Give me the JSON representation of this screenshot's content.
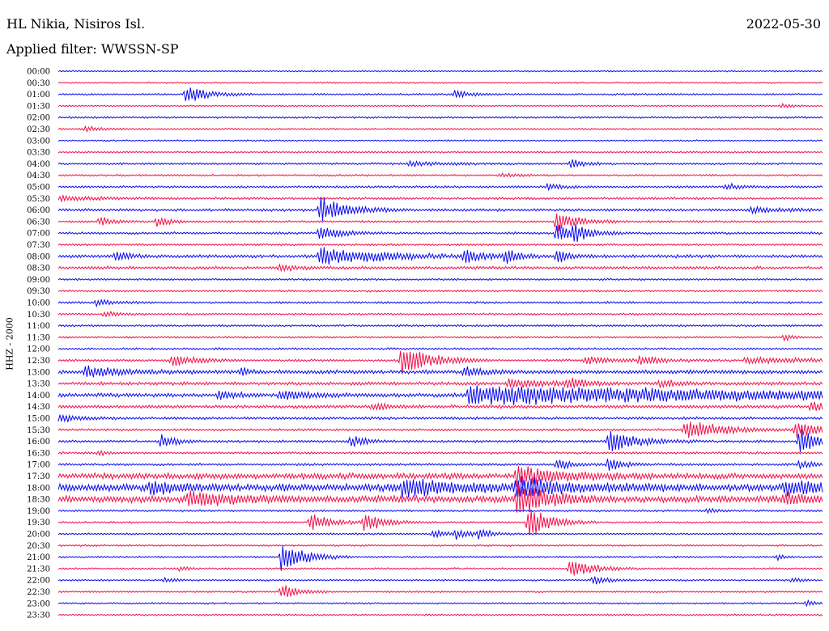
{
  "header": {
    "station": "HL Nikia, Nisiros Isl.",
    "date": "2022-05-30",
    "filter": "Applied filter: WWSSN-SP"
  },
  "chart_data": {
    "type": "line",
    "title": "HL Nikia, Nisiros Isl.",
    "ylabel": "HHZ - 2000",
    "grid": false,
    "legend": "none",
    "colors": [
      "#0a0af0",
      "#f0104a"
    ],
    "row_labels": [
      "00:00",
      "00:30",
      "01:00",
      "01:30",
      "02:00",
      "02:30",
      "03:00",
      "03:30",
      "04:00",
      "04:30",
      "05:00",
      "05:30",
      "06:00",
      "06:30",
      "07:00",
      "07:30",
      "08:00",
      "08:30",
      "09:00",
      "09:30",
      "10:00",
      "10:30",
      "11:00",
      "11:30",
      "12:00",
      "12:30",
      "13:00",
      "13:30",
      "14:00",
      "14:30",
      "15:00",
      "15:30",
      "16:00",
      "16:30",
      "17:00",
      "17:30",
      "18:00",
      "18:30",
      "19:00",
      "19:30",
      "20:00",
      "20:30",
      "21:00",
      "21:30",
      "22:00",
      "22:30",
      "23:00",
      "23:30"
    ],
    "row_noise": [
      1,
      1,
      1.2,
      1,
      1.3,
      1.2,
      1,
      1.2,
      1.4,
      1.3,
      1.5,
      1.6,
      1.8,
      1.4,
      1.6,
      1.4,
      2.2,
      2,
      1.3,
      1.3,
      1.5,
      1.4,
      1.4,
      1.3,
      1.4,
      1.6,
      2.6,
      2.3,
      2.6,
      2.2,
      1.8,
      1.6,
      1.6,
      1.5,
      1.6,
      4,
      5,
      4.5,
      1.4,
      1.3,
      1.2,
      1.2,
      1.2,
      1.2,
      1.2,
      1.2,
      1.2,
      1.2
    ],
    "events": [
      {
        "row": "01:00",
        "t": 0.167,
        "amp": 12,
        "dur": 0.03
      },
      {
        "row": "01:00",
        "t": 0.519,
        "amp": 6,
        "dur": 0.02
      },
      {
        "row": "01:30",
        "t": 0.947,
        "amp": 5,
        "dur": 0.01
      },
      {
        "row": "02:30",
        "t": 0.036,
        "amp": 4,
        "dur": 0.02
      },
      {
        "row": "04:00",
        "t": 0.46,
        "amp": 3,
        "dur": 0.06
      },
      {
        "row": "04:00",
        "t": 0.67,
        "amp": 6,
        "dur": 0.02
      },
      {
        "row": "04:30",
        "t": 0.58,
        "amp": 3,
        "dur": 0.02
      },
      {
        "row": "05:00",
        "t": 0.64,
        "amp": 4,
        "dur": 0.02
      },
      {
        "row": "05:00",
        "t": 0.874,
        "amp": 4,
        "dur": 0.02
      },
      {
        "row": "05:30",
        "t": 0.0,
        "amp": 3,
        "dur": 0.06
      },
      {
        "row": "06:00",
        "t": 0.342,
        "amp": 18,
        "dur": 0.04
      },
      {
        "row": "06:00",
        "t": 0.907,
        "amp": 4,
        "dur": 0.04
      },
      {
        "row": "06:30",
        "t": 0.054,
        "amp": 6,
        "dur": 0.02
      },
      {
        "row": "06:30",
        "t": 0.129,
        "amp": 7,
        "dur": 0.02
      },
      {
        "row": "06:30",
        "t": 0.652,
        "amp": 16,
        "dur": 0.03
      },
      {
        "row": "07:00",
        "t": 0.342,
        "amp": 10,
        "dur": 0.03
      },
      {
        "row": "07:00",
        "t": 0.652,
        "amp": 12,
        "dur": 0.03
      },
      {
        "row": "07:00",
        "t": 0.675,
        "amp": 10,
        "dur": 0.02
      },
      {
        "row": "08:00",
        "t": 0.075,
        "amp": 7,
        "dur": 0.02
      },
      {
        "row": "08:00",
        "t": 0.342,
        "amp": 14,
        "dur": 0.08
      },
      {
        "row": "08:00",
        "t": 0.532,
        "amp": 10,
        "dur": 0.02
      },
      {
        "row": "08:00",
        "t": 0.585,
        "amp": 10,
        "dur": 0.02
      },
      {
        "row": "08:00",
        "t": 0.652,
        "amp": 10,
        "dur": 0.02
      },
      {
        "row": "08:30",
        "t": 0.29,
        "amp": 5,
        "dur": 0.02
      },
      {
        "row": "10:00",
        "t": 0.05,
        "amp": 4,
        "dur": 0.03
      },
      {
        "row": "10:30",
        "t": 0.06,
        "amp": 4,
        "dur": 0.02
      },
      {
        "row": "11:30",
        "t": 0.95,
        "amp": 5,
        "dur": 0.01
      },
      {
        "row": "12:30",
        "t": 0.148,
        "amp": 10,
        "dur": 0.03
      },
      {
        "row": "12:30",
        "t": 0.449,
        "amp": 22,
        "dur": 0.04
      },
      {
        "row": "12:30",
        "t": 0.69,
        "amp": 5,
        "dur": 0.04
      },
      {
        "row": "12:30",
        "t": 0.76,
        "amp": 5,
        "dur": 0.04
      },
      {
        "row": "12:30",
        "t": 0.9,
        "amp": 4,
        "dur": 0.1
      },
      {
        "row": "13:00",
        "t": 0.036,
        "amp": 8,
        "dur": 0.05
      },
      {
        "row": "13:00",
        "t": 0.24,
        "amp": 6,
        "dur": 0.01
      },
      {
        "row": "13:00",
        "t": 0.532,
        "amp": 8,
        "dur": 0.02
      },
      {
        "row": "13:30",
        "t": 0.59,
        "amp": 7,
        "dur": 0.05
      },
      {
        "row": "13:30",
        "t": 0.666,
        "amp": 8,
        "dur": 0.02
      },
      {
        "row": "13:30",
        "t": 0.787,
        "amp": 5,
        "dur": 0.02
      },
      {
        "row": "14:00",
        "t": 0.21,
        "amp": 7,
        "dur": 0.02
      },
      {
        "row": "14:00",
        "t": 0.29,
        "amp": 6,
        "dur": 0.04
      },
      {
        "row": "14:00",
        "t": 0.537,
        "amp": 14,
        "dur": 0.45
      },
      {
        "row": "14:30",
        "t": 0.412,
        "amp": 5,
        "dur": 0.02
      },
      {
        "row": "14:30",
        "t": 0.985,
        "amp": 8,
        "dur": 0.02
      },
      {
        "row": "15:00",
        "t": 0.0,
        "amp": 6,
        "dur": 0.03
      },
      {
        "row": "15:30",
        "t": 0.82,
        "amp": 14,
        "dur": 0.05
      },
      {
        "row": "15:30",
        "t": 0.965,
        "amp": 14,
        "dur": 0.03
      },
      {
        "row": "16:00",
        "t": 0.135,
        "amp": 10,
        "dur": 0.02
      },
      {
        "row": "16:00",
        "t": 0.382,
        "amp": 9,
        "dur": 0.02
      },
      {
        "row": "16:00",
        "t": 0.72,
        "amp": 16,
        "dur": 0.04
      },
      {
        "row": "16:00",
        "t": 0.969,
        "amp": 18,
        "dur": 0.03
      },
      {
        "row": "16:30",
        "t": 0.053,
        "amp": 4,
        "dur": 0.01
      },
      {
        "row": "17:00",
        "t": 0.652,
        "amp": 8,
        "dur": 0.02
      },
      {
        "row": "17:00",
        "t": 0.72,
        "amp": 10,
        "dur": 0.02
      },
      {
        "row": "17:00",
        "t": 0.97,
        "amp": 6,
        "dur": 0.02
      },
      {
        "row": "17:30",
        "t": 0.6,
        "amp": 14,
        "dur": 0.06
      },
      {
        "row": "18:00",
        "t": 0.12,
        "amp": 10,
        "dur": 0.03
      },
      {
        "row": "18:00",
        "t": 0.45,
        "amp": 12,
        "dur": 0.08
      },
      {
        "row": "18:00",
        "t": 0.6,
        "amp": 12,
        "dur": 0.08
      },
      {
        "row": "18:00",
        "t": 0.95,
        "amp": 10,
        "dur": 0.05
      },
      {
        "row": "18:30",
        "t": 0.17,
        "amp": 12,
        "dur": 0.05
      },
      {
        "row": "18:30",
        "t": 0.6,
        "amp": 24,
        "dur": 0.04
      },
      {
        "row": "18:30",
        "t": 0.95,
        "amp": 8,
        "dur": 0.03
      },
      {
        "row": "19:00",
        "t": 0.85,
        "amp": 4,
        "dur": 0.01
      },
      {
        "row": "19:30",
        "t": 0.33,
        "amp": 12,
        "dur": 0.03
      },
      {
        "row": "19:30",
        "t": 0.4,
        "amp": 12,
        "dur": 0.03
      },
      {
        "row": "19:30",
        "t": 0.615,
        "amp": 22,
        "dur": 0.03
      },
      {
        "row": "20:00",
        "t": 0.49,
        "amp": 6,
        "dur": 0.02
      },
      {
        "row": "20:00",
        "t": 0.52,
        "amp": 6,
        "dur": 0.02
      },
      {
        "row": "20:00",
        "t": 0.55,
        "amp": 6,
        "dur": 0.02
      },
      {
        "row": "21:00",
        "t": 0.292,
        "amp": 24,
        "dur": 0.03
      },
      {
        "row": "21:00",
        "t": 0.94,
        "amp": 4,
        "dur": 0.01
      },
      {
        "row": "21:30",
        "t": 0.16,
        "amp": 4,
        "dur": 0.01
      },
      {
        "row": "21:30",
        "t": 0.67,
        "amp": 14,
        "dur": 0.03
      },
      {
        "row": "22:00",
        "t": 0.14,
        "amp": 4,
        "dur": 0.01
      },
      {
        "row": "22:00",
        "t": 0.7,
        "amp": 6,
        "dur": 0.02
      },
      {
        "row": "22:00",
        "t": 0.96,
        "amp": 4,
        "dur": 0.01
      },
      {
        "row": "22:30",
        "t": 0.292,
        "amp": 12,
        "dur": 0.02
      },
      {
        "row": "23:00",
        "t": 0.98,
        "amp": 4,
        "dur": 0.01
      }
    ]
  }
}
